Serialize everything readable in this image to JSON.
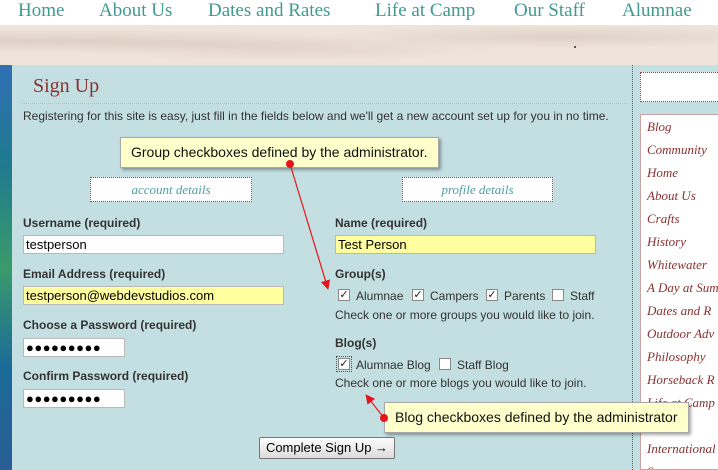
{
  "nav": {
    "items": [
      "Home",
      "About Us",
      "Dates and Rates",
      "Life at Camp",
      "Our Staff",
      "Alumnae"
    ]
  },
  "page": {
    "title": "Sign Up",
    "intro": "Registering for this site is easy, just fill in the fields below and we'll get a new account set up for you in no time."
  },
  "account": {
    "header": "account details",
    "username_label": "Username (required)",
    "username_value": "testperson",
    "email_label": "Email Address (required)",
    "email_value": "testperson@webdevstudios.com",
    "password_label": "Choose a Password (required)",
    "password_value": "●●●●●●●●●",
    "confirm_label": "Confirm Password (required)",
    "confirm_value": "●●●●●●●●●"
  },
  "profile": {
    "header": "profile details",
    "name_label": "Name (required)",
    "name_value": "Test Person",
    "groups_label": "Group(s)",
    "groups": [
      {
        "label": "Alumnae",
        "checked": true
      },
      {
        "label": "Campers",
        "checked": true
      },
      {
        "label": "Parents",
        "checked": true
      },
      {
        "label": "Staff",
        "checked": false
      }
    ],
    "groups_help": "Check one or more groups you would like to join.",
    "blogs_label": "Blog(s)",
    "blogs": [
      {
        "label": "Alumnae Blog",
        "checked": true
      },
      {
        "label": "Staff Blog",
        "checked": false
      }
    ],
    "blogs_help": "Check one or more blogs you would like to join."
  },
  "submit_label": "Complete Sign Up →",
  "sidebar": {
    "items": [
      "Blog",
      "Community",
      "Home",
      "About Us",
      "Crafts",
      "History",
      "Whitewater",
      "A Day at Sum",
      "Dates and R",
      "Outdoor Adv",
      "Philosophy",
      "Horseback R",
      "Life at Camp",
      "",
      "International",
      "Sports"
    ]
  },
  "callouts": {
    "groups": "Group checkboxes defined by the administrator.",
    "blogs": "Blog checkboxes defined by the administrator"
  },
  "colors": {
    "accent_teal": "#3f9a92",
    "title_red": "#8a3030",
    "background": "#c3dfe2",
    "highlight": "#ffffa0",
    "callout_bg": "#ffffcc",
    "arrow_red": "#e8141c"
  }
}
